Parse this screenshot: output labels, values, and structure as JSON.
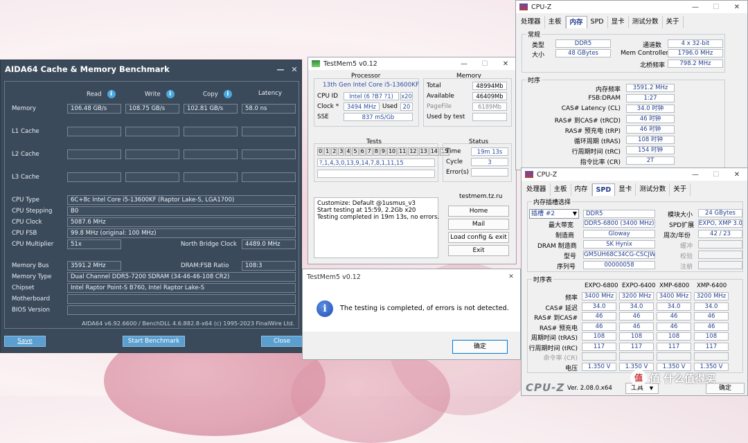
{
  "aida": {
    "title": "AIDA64 Cache & Memory Benchmark",
    "headers": {
      "read": "Read",
      "write": "Write",
      "copy": "Copy",
      "latency": "Latency"
    },
    "memory_label": "Memory",
    "memory": {
      "read": "106.48 GB/s",
      "write": "108.75 GB/s",
      "copy": "102.81 GB/s",
      "latency": "58.0 ns"
    },
    "l1_label": "L1 Cache",
    "l2_label": "L2 Cache",
    "l3_label": "L3 Cache",
    "cpu_type_label": "CPU Type",
    "cpu_type": "6C+8c Intel Core i5-13600KF  (Raptor Lake-S, LGA1700)",
    "cpu_stepping_label": "CPU Stepping",
    "cpu_stepping": "B0",
    "cpu_clock_label": "CPU Clock",
    "cpu_clock": "5087.6 MHz",
    "cpu_fsb_label": "CPU FSB",
    "cpu_fsb": "99.8 MHz  (original: 100 MHz)",
    "cpu_mult_label": "CPU Multiplier",
    "cpu_mult": "51x",
    "nb_clock_label": "North Bridge Clock",
    "nb_clock": "4489.0 MHz",
    "mem_bus_label": "Memory Bus",
    "mem_bus": "3591.2 MHz",
    "dram_fsb_label": "DRAM:FSB Ratio",
    "dram_fsb": "108:3",
    "mem_type_label": "Memory Type",
    "mem_type": "Dual Channel DDR5-7200 SDRAM  (34-46-46-108 CR2)",
    "chipset_label": "Chipset",
    "chipset": "Intel Raptor Point-S B760, Intel Raptor Lake-S",
    "motherboard_label": "Motherboard",
    "bios_label": "BIOS Version",
    "footer": "AIDA64 v6.92.6600 / BenchDLL 4.6.882.8-x64  (c) 1995-2023 FinalWire Ltd.",
    "save": "Save",
    "start": "Start Benchmark",
    "close": "Close"
  },
  "tm": {
    "title": "TestMem5 v0.12",
    "processor_h": "Processor",
    "processor": "13th Gen Intel Core i5-13600KF",
    "cpu_id_l": "CPU ID",
    "cpu_id": "Intel (6 ?B7 ?1)",
    "cpu_id_x": "x20",
    "clock_l": "Clock *",
    "clock": "3494 MHz",
    "used_l": "Used",
    "used": "20",
    "sse_l": "SSE",
    "sse": "837 mS/Gb",
    "memory_h": "Memory",
    "total_l": "Total",
    "total": "48994Mb",
    "avail_l": "Available",
    "avail": "46409Mb",
    "page_l": "PageFile",
    "page": "6189Mb",
    "used_test_l": "Used by test",
    "used_test": "",
    "tests_h": "Tests",
    "test_cells": [
      "0",
      "1",
      "2",
      "3",
      "4",
      "5",
      "6",
      "7",
      "8",
      "9",
      "10",
      "11",
      "12",
      "13",
      "14",
      "15"
    ],
    "sequence": "?,1,4,3,0,13,9,14,7,8,1,11,15",
    "status_h": "Status",
    "time_l": "Time",
    "time": "19m 13s",
    "cycle_l": "Cycle",
    "cycle": "3",
    "errors_l": "Error(s)",
    "errors": "",
    "log": [
      "Customize: Default @1usmus_v3",
      "Start testing at 15:59, 2.2Gb x20",
      "Testing completed in 19m 13s, no errors."
    ],
    "site": "testmem.tz.ru",
    "home": "Home",
    "mail": "Mail",
    "load": "Load config & exit",
    "exit": "Exit"
  },
  "dialog": {
    "title": "TestMem5 v0.12",
    "message": "The testing is completed, of errors is not detected.",
    "ok": "确定"
  },
  "cpuz1": {
    "title": "CPU-Z",
    "tabs": [
      "处理器",
      "主板",
      "内存",
      "SPD",
      "显卡",
      "测试分数",
      "关于"
    ],
    "selected_tab": "内存",
    "general_h": "常规",
    "type_l": "类型",
    "type": "DDR5",
    "channels_l": "通道数",
    "channels": "4 x 32-bit",
    "size_l": "大小",
    "size": "48 GBytes",
    "memctrl_l": "Mem Controller",
    "memctrl": "1796.0 MHz",
    "nb_l": "北桥频率",
    "nb": "798.2 MHz",
    "timing_h": "时序",
    "rows": [
      {
        "l": "内存频率",
        "v": "3591.2 MHz"
      },
      {
        "l": "FSB:DRAM",
        "v": "1:27"
      },
      {
        "l": "CAS# Latency (CL)",
        "v": "34.0 时钟"
      },
      {
        "l": "RAS# 到CAS# (tRCD)",
        "v": "46 时钟"
      },
      {
        "l": "RAS# 预充电 (tRP)",
        "v": "46 时钟"
      },
      {
        "l": "循环周期 (tRAS)",
        "v": "108 时钟"
      },
      {
        "l": "行周期时间 (tRC)",
        "v": "154 时钟"
      },
      {
        "l": "指令比率 (CR)",
        "v": "2T"
      }
    ]
  },
  "cpuz2": {
    "title": "CPU-Z",
    "tabs": [
      "处理器",
      "主板",
      "内存",
      "SPD",
      "显卡",
      "测试分数",
      "关于"
    ],
    "selected_tab": "SPD",
    "slot_h": "内存插槽选择",
    "slot": "插槽 #2",
    "slot_type": "DDR5",
    "module_size_l": "模块大小",
    "module_size": "24 GBytes",
    "max_bw_l": "最大带宽",
    "max_bw": "DDR5-6800 (3400 MHz)",
    "spd_ext_l": "SPD扩展",
    "spd_ext": "EXPO, XMP 3.0",
    "maker_l": "制造商",
    "maker": "Gloway",
    "week_l": "周次/年份",
    "week": "42 / 23",
    "dram_maker_l": "DRAM 制造商",
    "dram_maker": "SK Hynix",
    "buffer_l": "缓冲",
    "model_l": "型号",
    "model": "GM5UH68C34CG-CSCJWM",
    "verify_l": "校验",
    "serial_l": "序列号",
    "serial": "00000058",
    "reg_l": "注册",
    "timing_h": "时序表",
    "cols": [
      "EXPO-6800",
      "EXPO-6400",
      "XMP-6800",
      "XMP-6400"
    ],
    "rows": [
      {
        "l": "频率",
        "v": [
          "3400 MHz",
          "3200 MHz",
          "3400 MHz",
          "3200 MHz"
        ]
      },
      {
        "l": "CAS# 延迟",
        "v": [
          "34.0",
          "34.0",
          "34.0",
          "34.0"
        ]
      },
      {
        "l": "RAS# 到CAS#",
        "v": [
          "46",
          "46",
          "46",
          "46"
        ]
      },
      {
        "l": "RAS# 预充电",
        "v": [
          "46",
          "46",
          "46",
          "46"
        ]
      },
      {
        "l": "周期时间 (tRAS)",
        "v": [
          "108",
          "108",
          "108",
          "108"
        ]
      },
      {
        "l": "行周期时间 (tRC)",
        "v": [
          "117",
          "117",
          "117",
          "117"
        ]
      },
      {
        "l": "命令率 (CR)",
        "v": [
          "",
          "",
          "",
          ""
        ]
      },
      {
        "l": "电压",
        "v": [
          "1.350 V",
          "1.350 V",
          "1.350 V",
          "1.350 V"
        ]
      }
    ],
    "logo": "CPU-Z",
    "version": "Ver. 2.08.0.x64",
    "tools": "工具",
    "ok": "确定"
  },
  "watermark": "值 什么值得买"
}
